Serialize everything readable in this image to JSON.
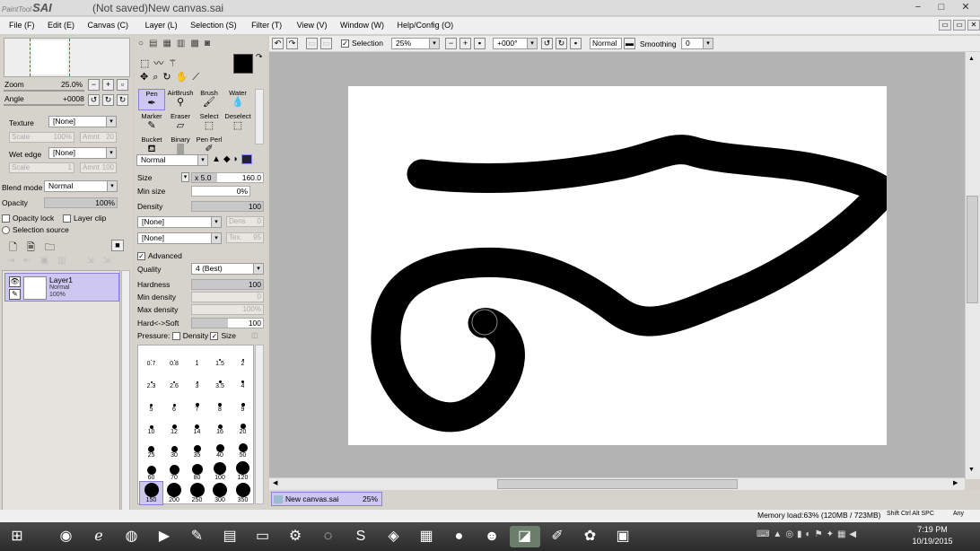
{
  "window": {
    "app_logo_small": "PaintTool",
    "app_logo": "SAI",
    "title": "(Not saved)New canvas.sai",
    "controls": [
      "−",
      "□",
      "✕"
    ]
  },
  "menu": [
    "File (F)",
    "Edit (E)",
    "Canvas (C)",
    "Layer (L)",
    "Selection (S)",
    "Filter (T)",
    "View (V)",
    "Window (W)",
    "Help/Config (O)"
  ],
  "navigator": {
    "zoom_label": "Zoom",
    "zoom_value": "25.0%",
    "angle_label": "Angle",
    "angle_value": "+0008"
  },
  "texture": {
    "label": "Texture",
    "value": "[None]",
    "scale_label": "Scale",
    "scale_value": "100%",
    "amount_label": "Amnt",
    "amount_value": "20"
  },
  "wetedge": {
    "label": "Wet edge",
    "value": "[None]",
    "scale_label": "Scale",
    "scale_value": "1",
    "amount_label": "Amnt",
    "amount_value": "100"
  },
  "blend": {
    "label": "Blend mode",
    "value": "Normal"
  },
  "opacity": {
    "label": "Opacity",
    "value": "100%",
    "fraction": 1.0
  },
  "layer_options": {
    "opacity_lock": "Opacity lock",
    "layer_clip": "Layer clip",
    "selection_source": "Selection source"
  },
  "layer": {
    "name": "Layer1",
    "mode": "Normal",
    "opacity": "100%"
  },
  "tools": [
    {
      "label": "Pen",
      "icon": "pen-icon"
    },
    {
      "label": "AirBrush",
      "icon": "airbrush-icon"
    },
    {
      "label": "Brush",
      "icon": "brush-icon"
    },
    {
      "label": "Water",
      "icon": "water-icon"
    },
    {
      "label": "Marker",
      "icon": "marker-icon"
    },
    {
      "label": "Eraser",
      "icon": "eraser-icon"
    },
    {
      "label": "Select",
      "icon": "select-icon"
    },
    {
      "label": "Deselect",
      "icon": "deselect-icon"
    },
    {
      "label": "Bucket",
      "icon": "bucket-icon"
    },
    {
      "label": "Binary",
      "icon": "binary-icon"
    },
    {
      "label": "Pen Perl",
      "icon": "pen-perl-icon"
    }
  ],
  "brush": {
    "mode": "Normal",
    "size_label": "Size",
    "size_mult": "x 5.0",
    "size_value": "160.0",
    "minsize_label": "Min size",
    "minsize_value": "0%",
    "density_label": "Density",
    "density_value": "100",
    "shape1": "[None]",
    "shape1_label": "Dens",
    "shape1_val": "0",
    "shape2": "[None]",
    "shape2_label": "Tex.",
    "shape2_val": "95",
    "advanced_label": "Advanced",
    "quality_label": "Quality",
    "quality_value": "4 (Best)",
    "hardness_label": "Hardness",
    "hardness_value": "100",
    "mindensity_label": "Min density",
    "mindensity_value": "0",
    "maxdensity_label": "Max density",
    "maxdensity_value": "100%",
    "hardsoft_label": "Hard<->Soft",
    "hardsoft_value": "100",
    "pressure_label": "Pressure:",
    "pressure_density": "Density",
    "pressure_size": "Size"
  },
  "brush_sizes": [
    "0.7",
    "0.8",
    "1",
    "1.5",
    "2",
    "2.3",
    "2.6",
    "3",
    "3.5",
    "4",
    "5",
    "6",
    "7",
    "8",
    "9",
    "10",
    "12",
    "14",
    "16",
    "20",
    "25",
    "30",
    "35",
    "40",
    "50",
    "60",
    "70",
    "80",
    "100",
    "120",
    "150",
    "200",
    "250",
    "300",
    "350"
  ],
  "canvas_toolbar": {
    "selection_label": "Selection",
    "zoom": "25%",
    "angle": "+000°",
    "mode": "Normal",
    "smoothing_label": "Smoothing",
    "smoothing_value": "0"
  },
  "doc_tab": {
    "name": "New canvas.sai",
    "zoom": "25%"
  },
  "status": {
    "memory": "Memory load:63% (120MB / 723MB)",
    "keys": "Shift Ctrl Alt SPC",
    "any": "Any"
  },
  "taskbar": {
    "apps": [
      "windows-start-icon",
      "chrome-icon",
      "ie-icon",
      "firefox-icon",
      "media-player-icon",
      "sai-tool-icon",
      "folder-flag-icon",
      "file-explorer-icon",
      "steam-icon",
      "obs-icon",
      "skype-icon",
      "gamepad-icon",
      "minecraft-icon",
      "recorder-icon",
      "character-icon",
      "paint-tool-sai-icon",
      "pen-tablet-icon",
      "spinner-icon",
      "minecraft-block-icon"
    ],
    "time": "7:19 PM",
    "date": "10/19/2015"
  },
  "colors": {
    "accent": "#b9b3ee",
    "layer_bg": "#cdc7f2",
    "canvas_bg": "#b3b3b3",
    "ink": "#000000"
  }
}
